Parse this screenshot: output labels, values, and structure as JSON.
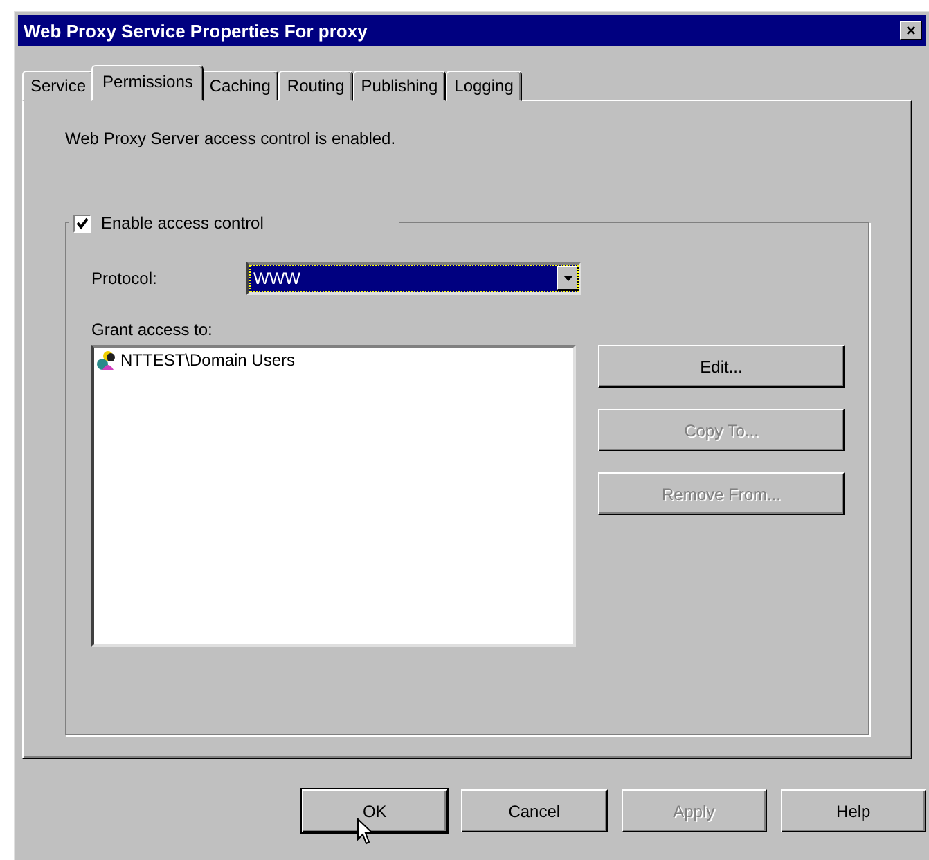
{
  "window": {
    "title": "Web Proxy Service Properties For proxy",
    "close": "×"
  },
  "tabs": [
    {
      "label": "Service",
      "selected": false
    },
    {
      "label": "Permissions",
      "selected": true
    },
    {
      "label": "Caching",
      "selected": false
    },
    {
      "label": "Routing",
      "selected": false
    },
    {
      "label": "Publishing",
      "selected": false
    },
    {
      "label": "Logging",
      "selected": false
    }
  ],
  "status_text": "Web Proxy Server access control is enabled.",
  "access_control": {
    "label": "Enable access control",
    "checked": true
  },
  "protocol": {
    "label": "Protocol:",
    "value": "WWW"
  },
  "grant_label": "Grant access to:",
  "grant_list": [
    {
      "name": "NTTEST\\Domain Users",
      "selected": false
    }
  ],
  "side_buttons": [
    {
      "label": "Edit...",
      "disabled": false
    },
    {
      "label": "Copy To...",
      "disabled": true
    },
    {
      "label": "Remove From...",
      "disabled": true
    }
  ],
  "buttons": [
    {
      "label": "OK",
      "disabled": false,
      "default": true
    },
    {
      "label": "Cancel",
      "disabled": false,
      "default": false
    },
    {
      "label": "Apply",
      "disabled": true,
      "default": false
    },
    {
      "label": "Help",
      "disabled": false,
      "default": false
    }
  ]
}
